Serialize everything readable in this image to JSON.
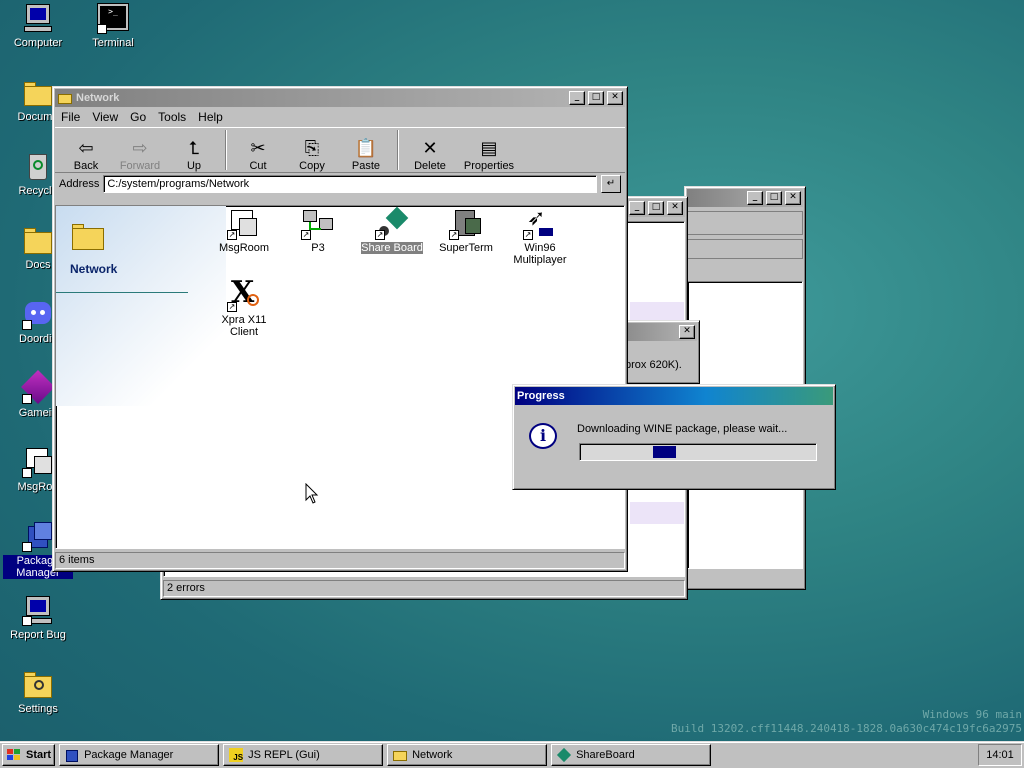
{
  "desktop": {
    "icons": [
      {
        "label": "Computer",
        "icon": "computer-icon"
      },
      {
        "label": "Terminal",
        "icon": "terminal-icon"
      },
      {
        "label": "Docume",
        "icon": "documents-folder-icon"
      },
      {
        "label": "Recycle",
        "icon": "recycle-bin-icon"
      },
      {
        "label": "Docs",
        "icon": "docs-folder-icon"
      },
      {
        "label": "Doordis",
        "icon": "doordis-icon"
      },
      {
        "label": "Gamein",
        "icon": "gamein-icon"
      },
      {
        "label": "MsgRoo",
        "icon": "msgroom-icon"
      },
      {
        "label": "Package Manager",
        "icon": "package-manager-icon"
      },
      {
        "label": "Report Bug",
        "icon": "report-bug-icon"
      },
      {
        "label": "Settings",
        "icon": "settings-icon"
      }
    ],
    "watermark": {
      "line1": "Windows 96 main",
      "line2": "Build 13202.cff11448.240418-1828.0a630c474c19fc6a2975"
    }
  },
  "network_window": {
    "title": "Network",
    "menu": [
      "File",
      "View",
      "Go",
      "Tools",
      "Help"
    ],
    "toolbar": {
      "back": "Back",
      "forward": "Forward",
      "up": "Up",
      "cut": "Cut",
      "copy": "Copy",
      "paste": "Paste",
      "delete": "Delete",
      "properties": "Properties"
    },
    "address_label": "Address",
    "address_value": "C:/system/programs/Network",
    "side_title": "Network",
    "files": [
      {
        "label": "MsgRoom",
        "icon": "msgroom-icon"
      },
      {
        "label": "P3",
        "icon": "p3-icon"
      },
      {
        "label": "Share Board",
        "icon": "share-board-icon"
      },
      {
        "label": "SuperTerm",
        "icon": "superterm-icon"
      },
      {
        "label": "Win96 Multiplayer",
        "icon": "win96-multiplayer-icon"
      },
      {
        "label": "Xpra X11 Client",
        "icon": "xpra-icon"
      }
    ],
    "status": "6 items"
  },
  "back_window": {
    "status": "2 errors"
  },
  "partial_dialog": {
    "text": "prox 620K)."
  },
  "progress_dialog": {
    "title": "Progress",
    "message": "Downloading WINE package, please wait...",
    "progress_fraction": 0.1
  },
  "taskbar": {
    "start": "Start",
    "items": [
      {
        "label": "Package Manager",
        "icon": "package-manager-icon"
      },
      {
        "label": "JS REPL (Gui)",
        "icon": "js-icon"
      },
      {
        "label": "Network",
        "icon": "folder-icon"
      },
      {
        "label": "ShareBoard",
        "icon": "shareboard-icon"
      }
    ],
    "clock": "14:01"
  },
  "colors": {
    "desktop": "#2f8484",
    "active_title": "#000080",
    "progress": "#000080"
  }
}
